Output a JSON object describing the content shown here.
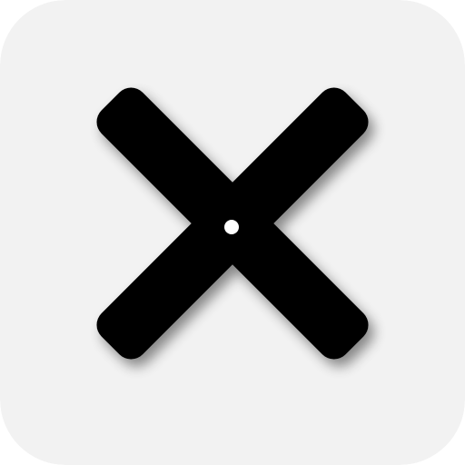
{
  "icon": {
    "name": "close-x-icon",
    "background_color": "#f2f2f2",
    "glyph_color": "#000000",
    "center_dot_color": "#ffffff",
    "shadow_color": "#000000"
  }
}
